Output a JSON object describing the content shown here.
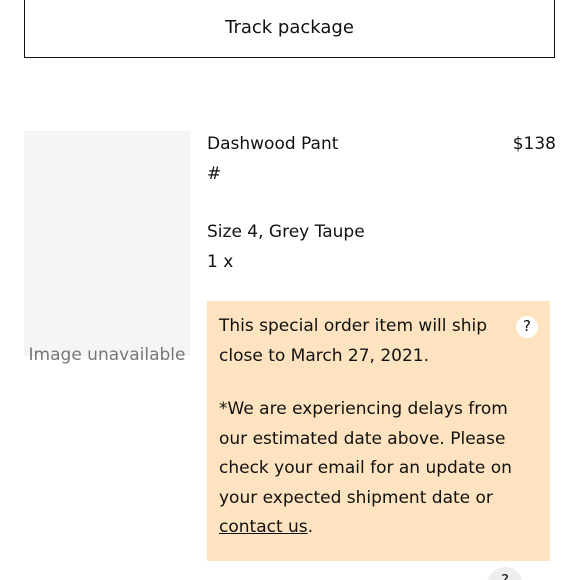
{
  "actions": {
    "track_label": "Track package"
  },
  "item": {
    "image_alt": "Image unavailable",
    "name": "Dashwood Pant",
    "price": "$138",
    "sku": "#",
    "variant": "Size 4, Grey Taupe",
    "quantity": "1 x"
  },
  "notice": {
    "ship_text": "This special order item will ship close to March 27, 2021.",
    "delay_text": "*We are experiencing delays from our estimated date above. Please check your email for an update on your expected shipment date or ",
    "contact_link": "contact us",
    "period": ".",
    "help_glyph": "?",
    "background": "#fde3bf"
  }
}
